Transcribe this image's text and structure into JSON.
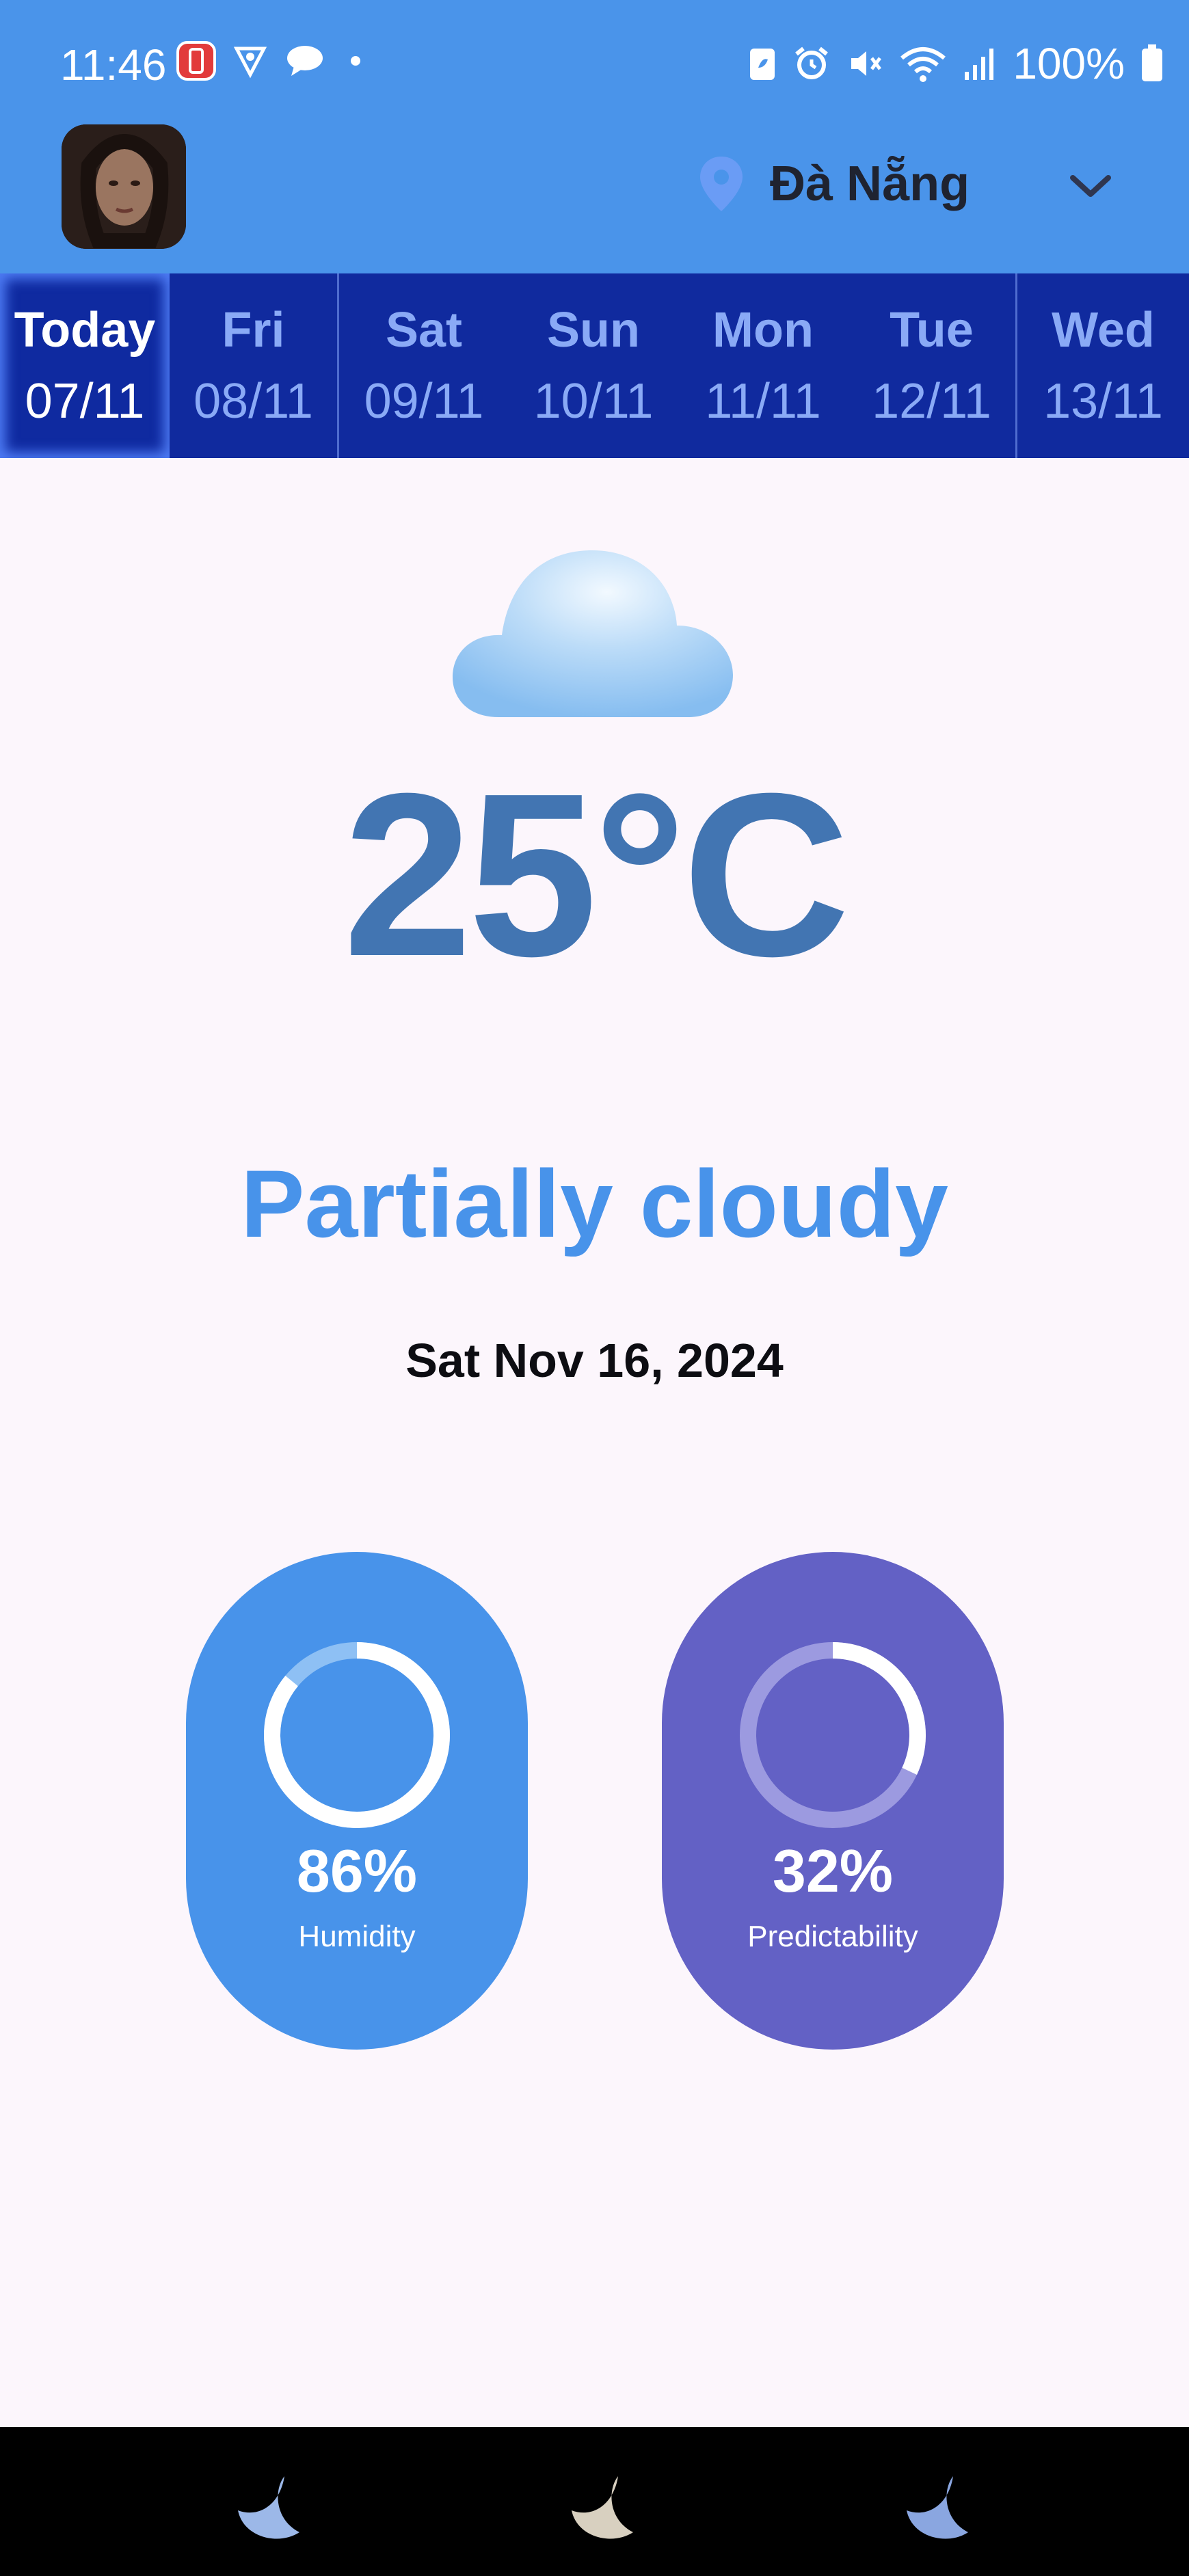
{
  "status_bar": {
    "time": "11:46",
    "battery": "100%"
  },
  "header": {
    "location": "Đà Nẵng"
  },
  "days": [
    {
      "day": "Today",
      "date": "07/11"
    },
    {
      "day": "Fri",
      "date": "08/11"
    },
    {
      "day": "Sat",
      "date": "09/11"
    },
    {
      "day": "Sun",
      "date": "10/11"
    },
    {
      "day": "Mon",
      "date": "11/11"
    },
    {
      "day": "Tue",
      "date": "12/11"
    },
    {
      "day": "Wed",
      "date": "13/11"
    }
  ],
  "weather": {
    "icon": "cloud-icon",
    "temperature": "25°C",
    "condition": "Partially cloudy",
    "date": "Sat Nov 16, 2024"
  },
  "stats": {
    "humidity": {
      "value": "86%",
      "label": "Humidity",
      "fraction": 0.86
    },
    "predictability": {
      "value": "32%",
      "label": "Predictability",
      "fraction": 0.32
    }
  },
  "colors": {
    "header_bg": "#4a94ea",
    "tabs_bg": "#102a9e",
    "temperature": "#4275b2",
    "condition": "#4893ea",
    "humidity_card": "#4893ea",
    "predictability_card": "#6361c5"
  }
}
